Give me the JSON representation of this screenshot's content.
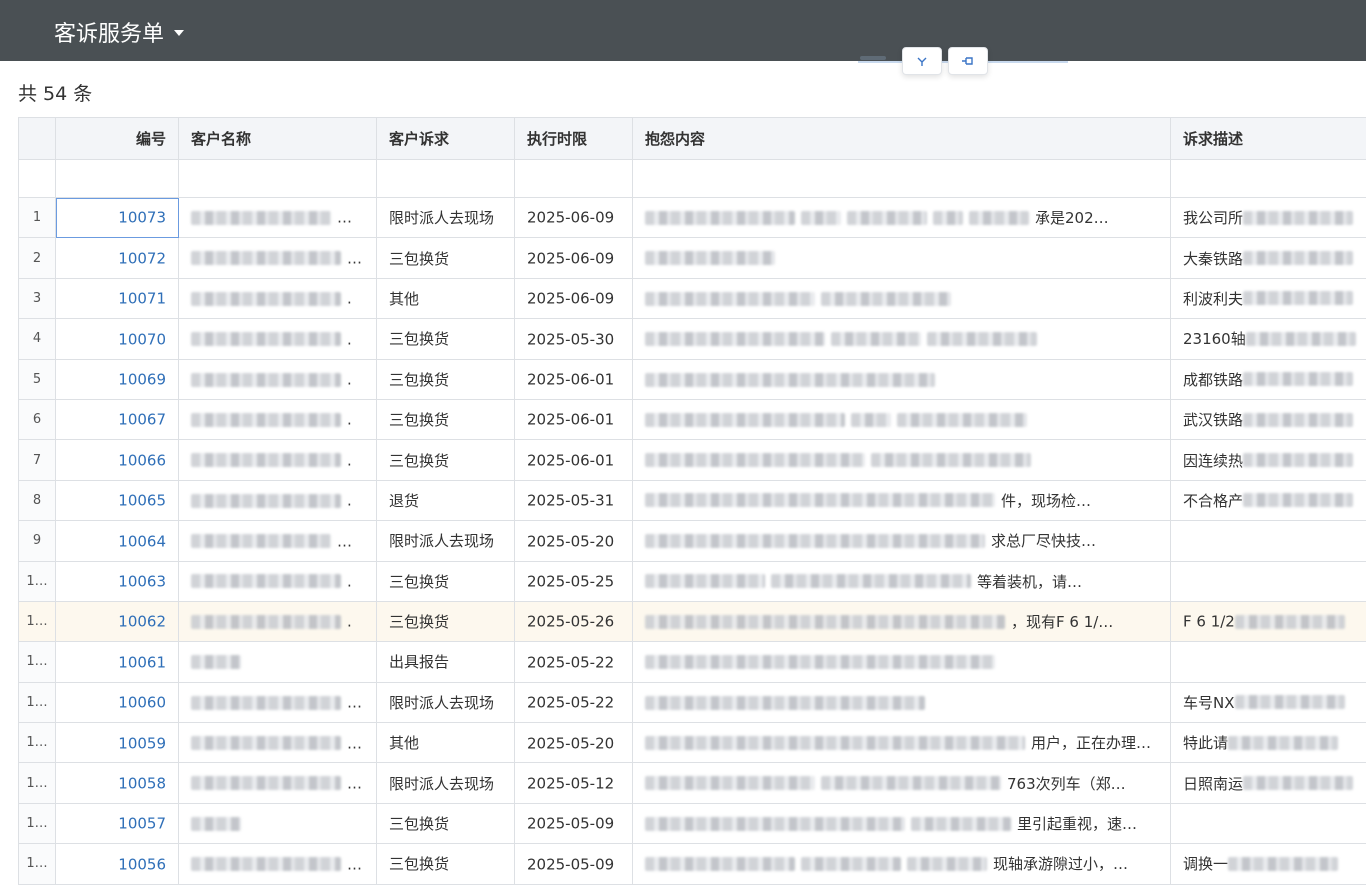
{
  "header": {
    "title": "客诉服务单"
  },
  "summary": {
    "count_text": "共 54 条"
  },
  "floating_toolbar": {
    "button1_icon": "collapse-icon",
    "button2_icon": "pin-icon"
  },
  "table": {
    "columns": [
      "编号",
      "客户名称",
      "客户诉求",
      "执行时限",
      "抱怨内容",
      "诉求描述"
    ],
    "rows": [
      {
        "idx": "1",
        "id": "10073",
        "name_tail": "…",
        "demand": "限时派人去现场",
        "deadline": "2025-06-09",
        "complaint_tail": "承是202…",
        "desc_head": "我公司所"
      },
      {
        "idx": "2",
        "id": "10072",
        "name_tail": "…",
        "demand": "三包换货",
        "deadline": "2025-06-09",
        "complaint_tail": "",
        "desc_head": "大秦铁路"
      },
      {
        "idx": "3",
        "id": "10071",
        "name_tail": ".",
        "demand": "其他",
        "deadline": "2025-06-09",
        "complaint_tail": "",
        "desc_head": "利波利夫"
      },
      {
        "idx": "4",
        "id": "10070",
        "name_tail": ".",
        "demand": "三包换货",
        "deadline": "2025-05-30",
        "complaint_tail": "",
        "desc_head": "23160轴"
      },
      {
        "idx": "5",
        "id": "10069",
        "name_tail": ".",
        "demand": "三包换货",
        "deadline": "2025-06-01",
        "complaint_tail": "",
        "desc_head": "成都铁路"
      },
      {
        "idx": "6",
        "id": "10067",
        "name_tail": ".",
        "demand": "三包换货",
        "deadline": "2025-06-01",
        "complaint_tail": "",
        "desc_head": "武汉铁路"
      },
      {
        "idx": "7",
        "id": "10066",
        "name_tail": ".",
        "demand": "三包换货",
        "deadline": "2025-06-01",
        "complaint_tail": "",
        "desc_head": "因连续热"
      },
      {
        "idx": "8",
        "id": "10065",
        "name_tail": ".",
        "demand": "退货",
        "deadline": "2025-05-31",
        "complaint_tail": "件，现场检…",
        "desc_head": "不合格产"
      },
      {
        "idx": "9",
        "id": "10064",
        "name_tail": "…",
        "demand": "限时派人去现场",
        "deadline": "2025-05-20",
        "complaint_tail": "求总厂尽快技…",
        "desc_head": ""
      },
      {
        "idx": "1…",
        "id": "10063",
        "name_tail": ".",
        "demand": "三包换货",
        "deadline": "2025-05-25",
        "complaint_tail": "等着装机，请…",
        "desc_head": ""
      },
      {
        "idx": "1…",
        "id": "10062",
        "name_tail": ".",
        "demand": "三包换货",
        "deadline": "2025-05-26",
        "complaint_tail": "，现有F 6 1/…",
        "desc_head": "F 6 1/2"
      },
      {
        "idx": "1…",
        "id": "10061",
        "name_tail": "",
        "demand": "出具报告",
        "deadline": "2025-05-22",
        "complaint_tail": "",
        "desc_head": ""
      },
      {
        "idx": "1…",
        "id": "10060",
        "name_tail": "…",
        "demand": "限时派人去现场",
        "deadline": "2025-05-22",
        "complaint_tail": "",
        "desc_head": "车号NX"
      },
      {
        "idx": "1…",
        "id": "10059",
        "name_tail": "…",
        "demand": "其他",
        "deadline": "2025-05-20",
        "complaint_tail": "用户，正在办理…",
        "desc_head": "特此请"
      },
      {
        "idx": "1…",
        "id": "10058",
        "name_tail": "…",
        "demand": "限时派人去现场",
        "deadline": "2025-05-12",
        "complaint_tail": "763次列车（郑…",
        "desc_head": "日照南运"
      },
      {
        "idx": "1…",
        "id": "10057",
        "name_tail": "",
        "demand": "三包换货",
        "deadline": "2025-05-09",
        "complaint_tail": "里引起重视，速…",
        "desc_head": ""
      },
      {
        "idx": "1…",
        "id": "10056",
        "name_tail": "…",
        "demand": "三包换货",
        "deadline": "2025-05-09",
        "complaint_tail": "现轴承游隙过小，…",
        "desc_head": "调换一"
      }
    ]
  },
  "colors": {
    "topbar": "#4a5054",
    "link": "#2f6fb8",
    "active_row": "#fdf8ee"
  }
}
